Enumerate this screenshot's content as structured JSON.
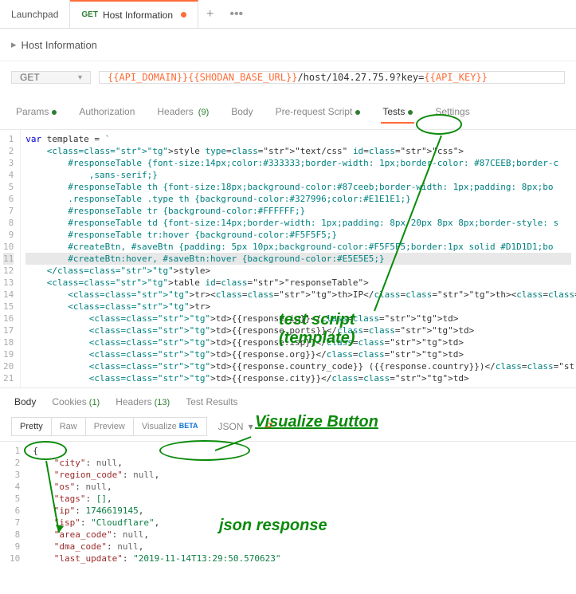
{
  "topTabs": [
    {
      "label": "Launchpad",
      "method": "",
      "active": false,
      "dot": false
    },
    {
      "label": "Host Information",
      "method": "GET",
      "active": true,
      "dot": true
    }
  ],
  "tabPlus": "+",
  "tabMore": "•••",
  "sectionTitle": "Host Information",
  "request": {
    "method": "GET",
    "url": {
      "v1": "{{API_DOMAIN}}",
      "v2": "{{SHODAN_BASE_URL}}",
      "p1": "/host/104.27.75.9?key=",
      "v3": "{{API_KEY}}"
    }
  },
  "subtabs": [
    {
      "label": "Params",
      "ind": true
    },
    {
      "label": "Authorization"
    },
    {
      "label": "Headers",
      "count": "(9)"
    },
    {
      "label": "Body"
    },
    {
      "label": "Pre-request Script",
      "ind": true
    },
    {
      "label": "Tests",
      "ind": true,
      "active": true
    },
    {
      "label": "Settings"
    }
  ],
  "codeLines": [
    "var template = `",
    "    <style type=\"text/css\" id=\"css\">",
    "        #responseTable {font-size:14px;color:#333333;border-width: 1px;border-color: #87CEEB;border-c",
    "            ,sans-serif;}",
    "        #responseTable th {font-size:18px;background-color:#87ceeb;border-width: 1px;padding: 8px;bo",
    "        .responseTable .type th {background-color:#327996;color:#E1E1E1;}",
    "        #responseTable tr {background-color:#FFFFFF;}",
    "        #responseTable td {font-size:14px;border-width: 1px;padding: 8px 20px 8px 8px;border-style: s",
    "        #responseTable tr:hover {background-color:#F5F5F5;}",
    "        #createBtn, #saveBtn {padding: 5px 10px;background-color:#F5F5F5;border:1px solid #D1D1D1;bo",
    "        #createBtn:hover, #saveBtn:hover {background-color:#E5E5E5;}",
    "    </style>",
    "    <table id=\"responseTable\">",
    "        <tr><th>IP</th><th>Ports</th><th>ISP</th><th>Organisation</th><th>Country</th><th>City</th",
    "        <tr>",
    "            <td>{{response.ip}}</td>",
    "            <td>{{response.ports}}</td>",
    "            <td>{{response.isp}}</td>",
    "            <td>{{response.org}}</td>",
    "            <td>{{response.country_code}} ({{response.country}})</td>",
    "            <td>{{response.city}}</td>"
  ],
  "hlLine": 11,
  "respTabs": [
    {
      "label": "Body",
      "active": true
    },
    {
      "label": "Cookies",
      "count": "(1)"
    },
    {
      "label": "Headers",
      "count": "(13)"
    },
    {
      "label": "Test Results"
    }
  ],
  "viewSeg": [
    {
      "label": "Pretty",
      "active": true
    },
    {
      "label": "Raw"
    },
    {
      "label": "Preview"
    },
    {
      "label": "Visualize",
      "beta": "BETA"
    }
  ],
  "fmt": "JSON",
  "jsonLines": [
    {
      "raw": "{"
    },
    {
      "key": "city",
      "val": "null",
      "t": "nul"
    },
    {
      "key": "region_code",
      "val": "null",
      "t": "nul"
    },
    {
      "key": "os",
      "val": "null",
      "t": "nul"
    },
    {
      "key": "tags",
      "val": "[]",
      "t": "arr"
    },
    {
      "key": "ip",
      "val": "1746619145",
      "t": "num"
    },
    {
      "key": "isp",
      "val": "\"Cloudflare\"",
      "t": "str"
    },
    {
      "key": "area_code",
      "val": "null",
      "t": "nul"
    },
    {
      "key": "dma_code",
      "val": "null",
      "t": "nul"
    },
    {
      "key": "last_update",
      "val": "\"2019-11-14T13:29:50.570623\"",
      "t": "str",
      "last": true
    }
  ],
  "annot": {
    "script": "test script\n(template)",
    "vis": "Visualize Button",
    "json": "json response"
  }
}
